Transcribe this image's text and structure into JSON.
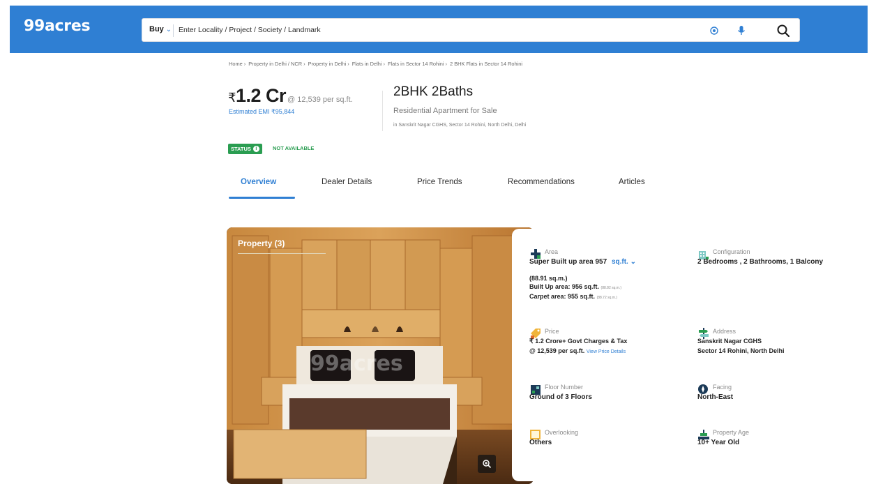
{
  "header": {
    "logo": "99acres",
    "search": {
      "type_label": "Buy",
      "placeholder": "Enter Locality / Project / Society / Landmark"
    }
  },
  "breadcrumb": [
    "Home",
    "Property in Delhi / NCR",
    "Property in Delhi",
    "Flats in Delhi",
    "Flats in Sector 14 Rohini",
    "2 BHK Flats in Sector 14 Rohini"
  ],
  "listing": {
    "price_symbol": "₹",
    "price": "1.2 Cr",
    "price_per_sqft": "@ 12,539 per sq.ft.",
    "emi": "Estimated EMI ₹95,844",
    "title": "2BHK 2Baths",
    "subtitle": "Residential Apartment for Sale",
    "location": "in Sanskrit Nagar CGHS, Sector 14 Rohini, North Delhi, Delhi",
    "status_label": "STATUS",
    "status_value": "NOT AVAILABLE"
  },
  "tabs": [
    {
      "label": "Overview",
      "active": true
    },
    {
      "label": "Dealer Details",
      "active": false
    },
    {
      "label": "Price Trends",
      "active": false
    },
    {
      "label": "Recommendations",
      "active": false
    },
    {
      "label": "Articles",
      "active": false
    }
  ],
  "gallery": {
    "label": "Property (3)",
    "watermark": "99acres"
  },
  "details": {
    "area": {
      "label": "Area",
      "super_built_up": "Super Built up area 957",
      "unit": "sq.ft.",
      "super_built_up_sqm": "(88.91 sq.m.)",
      "built_up": "Built Up area: 956 sq.ft.",
      "built_up_sqm": "(88.82 sq.m.)",
      "carpet": "Carpet area: 955 sq.ft.",
      "carpet_sqm": "(88.72 sq.m.)"
    },
    "configuration": {
      "label": "Configuration",
      "value": "2 Bedrooms , 2 Bathrooms, 1 Balcony"
    },
    "price": {
      "label": "Price",
      "value": "₹ 1.2 Crore+ Govt Charges & Tax",
      "per_sqft": "@ 12,539 per sq.ft.",
      "link": "View Price Details"
    },
    "address": {
      "label": "Address",
      "line1": "Sanskrit Nagar CGHS",
      "line2": "Sector 14 Rohini, North Delhi"
    },
    "floor": {
      "label": "Floor Number",
      "value": "Ground of 3 Floors"
    },
    "facing": {
      "label": "Facing",
      "value": "North-East"
    },
    "overlooking": {
      "label": "Overlooking",
      "value": "Others"
    },
    "age": {
      "label": "Property Age",
      "value": "10+ Year Old"
    }
  },
  "colors": {
    "brand_blue": "#2f7fd3",
    "status_green": "#2a9d51"
  }
}
